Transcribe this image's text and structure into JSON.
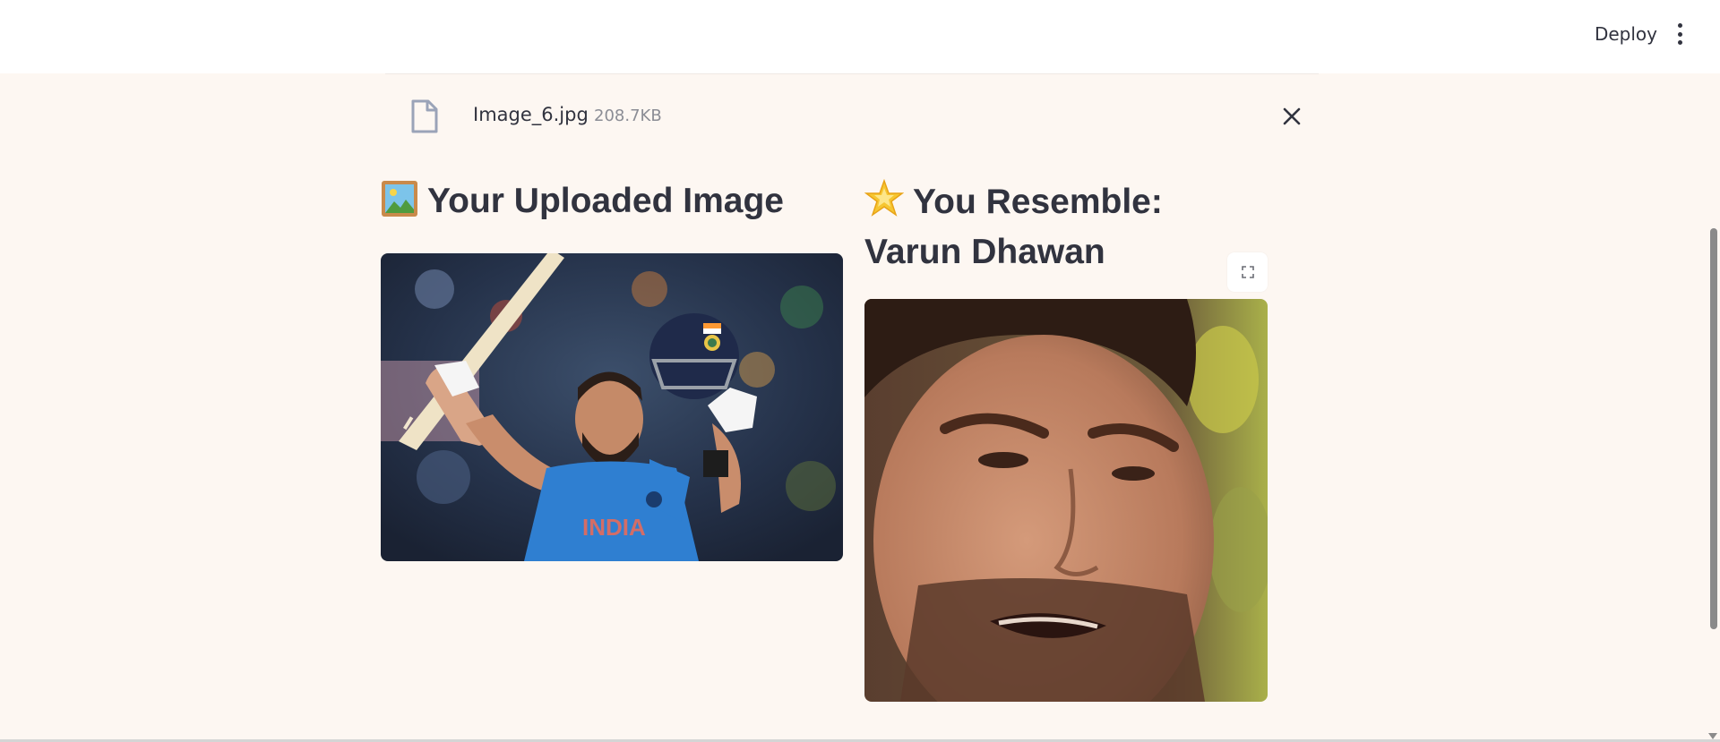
{
  "header": {
    "deploy_label": "Deploy",
    "menu_icon": "more-vertical-icon"
  },
  "uploaded_file": {
    "name": "Image_6.jpg",
    "size": "208.7KB",
    "icon": "file-icon",
    "close_icon": "close-icon"
  },
  "left_column": {
    "emoji": "🖼️",
    "title": "Your Uploaded Image",
    "image_alt": "Uploaded image of cricket player celebrating in blue India jersey"
  },
  "right_column": {
    "emoji": "🌟",
    "title": "You Resemble: Varun Dhawan",
    "image_alt": "Close-up face image of Varun Dhawan",
    "fullscreen_icon": "fullscreen-icon"
  },
  "colors": {
    "background": "#fdf7f2",
    "header": "#ffffff",
    "text": "#31333f",
    "muted": "#8b8d95"
  }
}
